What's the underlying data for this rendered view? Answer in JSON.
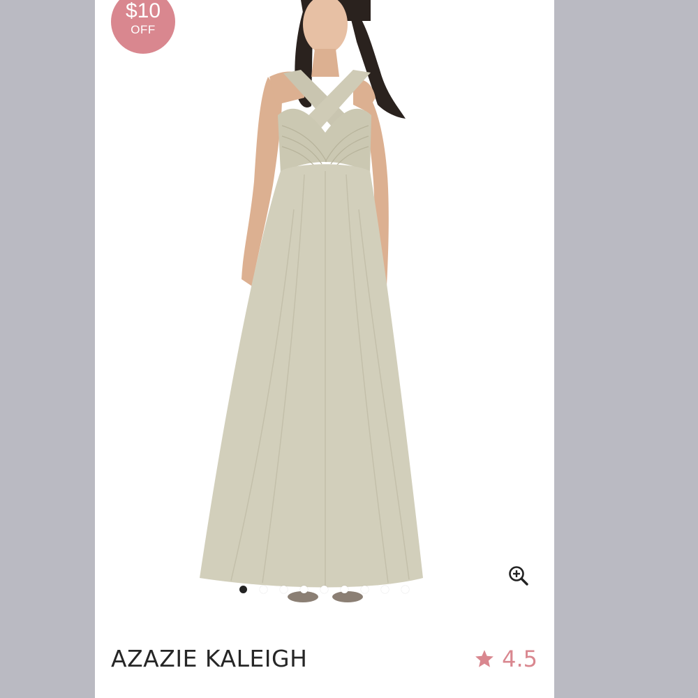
{
  "badge": {
    "amount": "$10",
    "label": "OFF"
  },
  "product": {
    "title": "AZAZIE KALEIGH",
    "rating": "4.5"
  },
  "gallery": {
    "slide_count": 9,
    "active_index": 0,
    "zoom_icon": "zoom-in-icon"
  },
  "colors": {
    "accent": "#d9878f",
    "dress": "#d2cfbb",
    "background": "#babac2"
  }
}
